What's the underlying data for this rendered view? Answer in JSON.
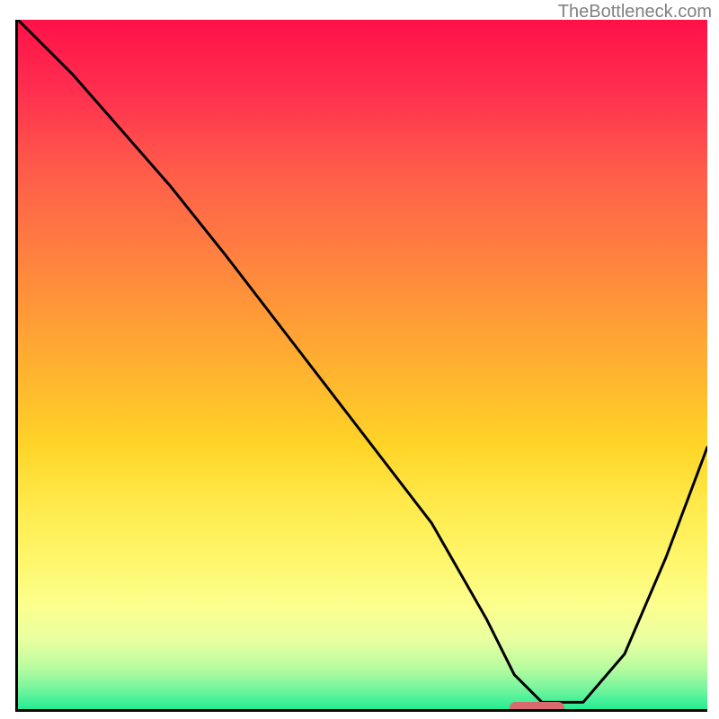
{
  "watermark": "TheBottleneck.com",
  "chart_data": {
    "type": "line",
    "title": "",
    "xlabel": "",
    "ylabel": "",
    "xlim": [
      0,
      100
    ],
    "ylim": [
      0,
      100
    ],
    "x": [
      0,
      8,
      22,
      30,
      40,
      50,
      60,
      68,
      72,
      76,
      82,
      88,
      94,
      100
    ],
    "values": [
      100,
      92,
      76,
      66,
      53,
      40,
      27,
      13,
      5,
      1,
      1,
      8,
      22,
      38
    ],
    "marker": {
      "x_start": 71,
      "x_end": 79,
      "y": 0.5
    },
    "gradient": {
      "stops": [
        {
          "pos": 0,
          "color": "#ff1148"
        },
        {
          "pos": 10,
          "color": "#ff2e4f"
        },
        {
          "pos": 22,
          "color": "#ff5c4a"
        },
        {
          "pos": 32,
          "color": "#ff7a42"
        },
        {
          "pos": 42,
          "color": "#ff9838"
        },
        {
          "pos": 52,
          "color": "#ffb62f"
        },
        {
          "pos": 62,
          "color": "#ffd527"
        },
        {
          "pos": 70,
          "color": "#ffe94a"
        },
        {
          "pos": 78,
          "color": "#fff66a"
        },
        {
          "pos": 85,
          "color": "#fcff8e"
        },
        {
          "pos": 90,
          "color": "#e9ffa0"
        },
        {
          "pos": 94,
          "color": "#b8fca0"
        },
        {
          "pos": 97,
          "color": "#77f59d"
        },
        {
          "pos": 100,
          "color": "#23ed95"
        }
      ]
    }
  }
}
